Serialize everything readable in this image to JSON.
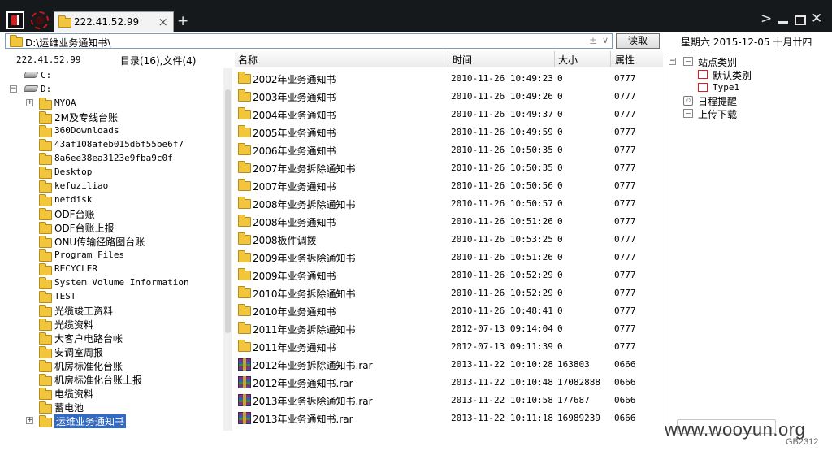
{
  "tab": {
    "title": "222.41.52.99",
    "close": "×",
    "add": "+"
  },
  "window": {
    "chevron": ">",
    "close": "✕"
  },
  "address": {
    "path": "D:\\运维业务通知书\\",
    "sort_glyph": "±",
    "dropdown_glyph": "∨",
    "read_button": "读取"
  },
  "date_display": "星期六  2015-12-05  十月廿四",
  "left_header": {
    "ip": "222.41.52.99",
    "count": "目录(16),文件(4)"
  },
  "columns": {
    "name": "名称",
    "time": "时间",
    "size": "大小",
    "attr": "属性"
  },
  "tree": {
    "drives": [
      {
        "label": "C:",
        "expander": ""
      },
      {
        "label": "D:",
        "expander": "−"
      }
    ],
    "folders": [
      {
        "label": "MYOA",
        "expander": "+"
      },
      {
        "label": "2M及专线台账",
        "expander": ""
      },
      {
        "label": "360Downloads",
        "expander": ""
      },
      {
        "label": "43af108afeb015d6f55be6f7",
        "expander": ""
      },
      {
        "label": "8a6ee38ea3123e9fba9c0f",
        "expander": ""
      },
      {
        "label": "Desktop",
        "expander": ""
      },
      {
        "label": "kefuziliao",
        "expander": ""
      },
      {
        "label": "netdisk",
        "expander": ""
      },
      {
        "label": "ODF台账",
        "expander": ""
      },
      {
        "label": "ODF台账上报",
        "expander": ""
      },
      {
        "label": "ONU传输径路图台账",
        "expander": ""
      },
      {
        "label": "Program Files",
        "expander": ""
      },
      {
        "label": "RECYCLER",
        "expander": ""
      },
      {
        "label": "System Volume Information",
        "expander": ""
      },
      {
        "label": "TEST",
        "expander": ""
      },
      {
        "label": "光缆竣工资料",
        "expander": ""
      },
      {
        "label": "光缆资料",
        "expander": ""
      },
      {
        "label": "大客户电路台帐",
        "expander": ""
      },
      {
        "label": "安调室周报",
        "expander": ""
      },
      {
        "label": "机房标准化台账",
        "expander": ""
      },
      {
        "label": "机房标准化台账上报",
        "expander": ""
      },
      {
        "label": "电缆资料",
        "expander": ""
      },
      {
        "label": "蓄电池",
        "expander": ""
      },
      {
        "label": "运维业务通知书",
        "expander": "+",
        "selected": true
      }
    ]
  },
  "files": [
    {
      "name": "2002年业务通知书",
      "time": "2010-11-26  10:49:23",
      "size": "0",
      "attr": "0777",
      "type": "folder"
    },
    {
      "name": "2003年业务通知书",
      "time": "2010-11-26  10:49:26",
      "size": "0",
      "attr": "0777",
      "type": "folder"
    },
    {
      "name": "2004年业务通知书",
      "time": "2010-11-26  10:49:37",
      "size": "0",
      "attr": "0777",
      "type": "folder"
    },
    {
      "name": "2005年业务通知书",
      "time": "2010-11-26  10:49:59",
      "size": "0",
      "attr": "0777",
      "type": "folder"
    },
    {
      "name": "2006年业务通知书",
      "time": "2010-11-26  10:50:35",
      "size": "0",
      "attr": "0777",
      "type": "folder"
    },
    {
      "name": "2007年业务拆除通知书",
      "time": "2010-11-26  10:50:35",
      "size": "0",
      "attr": "0777",
      "type": "folder"
    },
    {
      "name": "2007年业务通知书",
      "time": "2010-11-26  10:50:56",
      "size": "0",
      "attr": "0777",
      "type": "folder"
    },
    {
      "name": "2008年业务拆除通知书",
      "time": "2010-11-26  10:50:57",
      "size": "0",
      "attr": "0777",
      "type": "folder"
    },
    {
      "name": "2008年业务通知书",
      "time": "2010-11-26  10:51:26",
      "size": "0",
      "attr": "0777",
      "type": "folder"
    },
    {
      "name": "2008板件调拨",
      "time": "2010-11-26  10:53:25",
      "size": "0",
      "attr": "0777",
      "type": "folder"
    },
    {
      "name": "2009年业务拆除通知书",
      "time": "2010-11-26  10:51:26",
      "size": "0",
      "attr": "0777",
      "type": "folder"
    },
    {
      "name": "2009年业务通知书",
      "time": "2010-11-26  10:52:29",
      "size": "0",
      "attr": "0777",
      "type": "folder"
    },
    {
      "name": "2010年业务拆除通知书",
      "time": "2010-11-26  10:52:29",
      "size": "0",
      "attr": "0777",
      "type": "folder"
    },
    {
      "name": "2010年业务通知书",
      "time": "2010-11-26  10:48:41",
      "size": "0",
      "attr": "0777",
      "type": "folder"
    },
    {
      "name": "2011年业务拆除通知书",
      "time": "2012-07-13  09:14:04",
      "size": "0",
      "attr": "0777",
      "type": "folder"
    },
    {
      "name": "2011年业务通知书",
      "time": "2012-07-13  09:11:39",
      "size": "0",
      "attr": "0777",
      "type": "folder"
    },
    {
      "name": "2012年业务拆除通知书.rar",
      "time": "2013-11-22  10:10:28",
      "size": "163803",
      "attr": "0666",
      "type": "archive"
    },
    {
      "name": "2012年业务通知书.rar",
      "time": "2013-11-22  10:10:48",
      "size": "17082888",
      "attr": "0666",
      "type": "archive"
    },
    {
      "name": "2013年业务拆除通知书.rar",
      "time": "2013-11-22  10:10:58",
      "size": "177687",
      "attr": "0666",
      "type": "archive"
    },
    {
      "name": "2013年业务通知书.rar",
      "time": "2013-11-22  10:11:18",
      "size": "16989239",
      "attr": "0666",
      "type": "archive"
    }
  ],
  "right_panel": {
    "items": [
      {
        "label": "站点类别",
        "expander": "−",
        "icon": "category-icon",
        "level": 0
      },
      {
        "label": "默认类别",
        "expander": "",
        "icon": "red-box-icon",
        "level": 1
      },
      {
        "label": "Type1",
        "expander": "",
        "icon": "red-box-icon",
        "level": 1
      },
      {
        "label": "日程提醒",
        "expander": "",
        "icon": "clock-icon",
        "level": 0
      },
      {
        "label": "上传下载",
        "expander": "",
        "icon": "category-icon",
        "level": 0
      }
    ]
  },
  "watermark": {
    "main": "www.wooyun.org",
    "sub": "GB2312"
  },
  "colors": {
    "titlebar": "#15191c",
    "selection": "#316ac5",
    "folder": "#f2c63c"
  }
}
